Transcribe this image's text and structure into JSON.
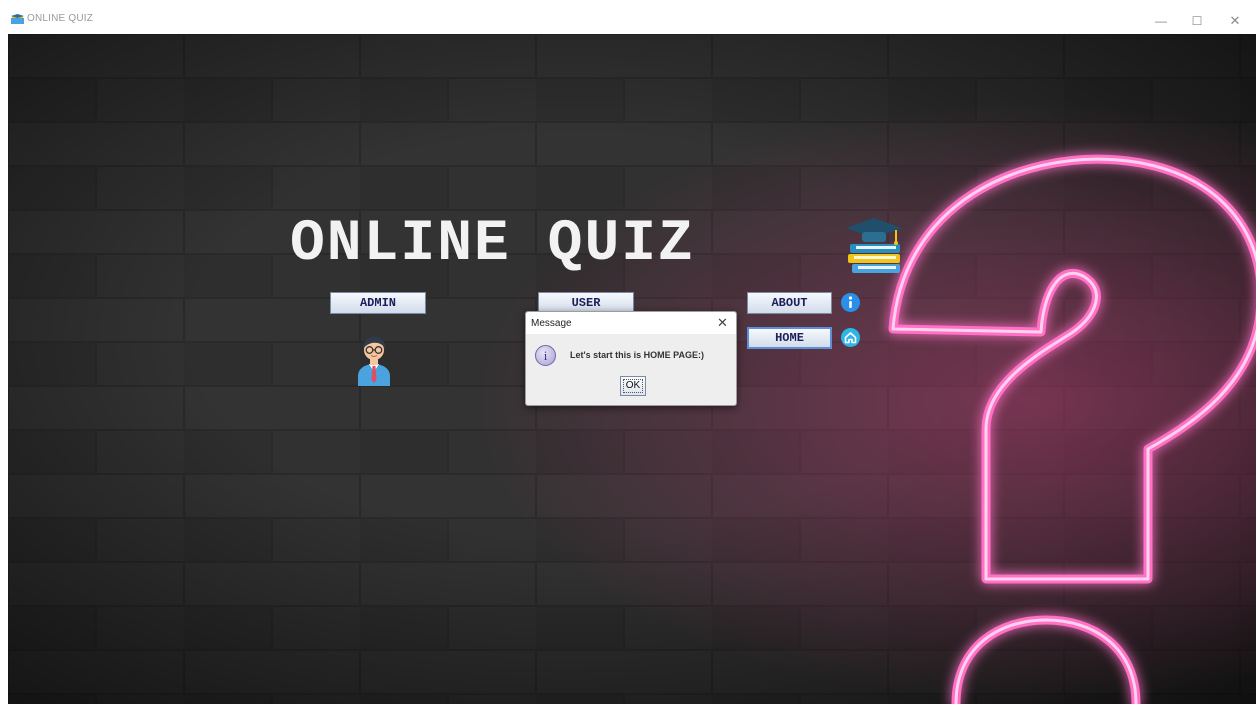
{
  "window": {
    "title": "ONLINE QUIZ",
    "controls": {
      "minimize": "—",
      "maximize": "☐",
      "close": "✕"
    }
  },
  "heading": "ONLINE QUIZ",
  "buttons": {
    "admin": "ADMIN",
    "user": "USER",
    "about": "ABOUT",
    "home": "HOME"
  },
  "icons": {
    "title": "quiz-app-icon",
    "heading": "books-graduation-cap-icon",
    "admin": "admin-avatar-icon",
    "about": "info-icon",
    "home": "home-icon",
    "dialog": "information-icon"
  },
  "dialog": {
    "title": "Message",
    "close": "✕",
    "info_glyph": "i",
    "message": "Let's start this is HOME PAGE:)",
    "ok_label": "OK"
  },
  "colors": {
    "background": "#222222",
    "neon": "#ff6fc6",
    "heading": "#f2f2f2",
    "button_text": "#1d1f5a"
  }
}
